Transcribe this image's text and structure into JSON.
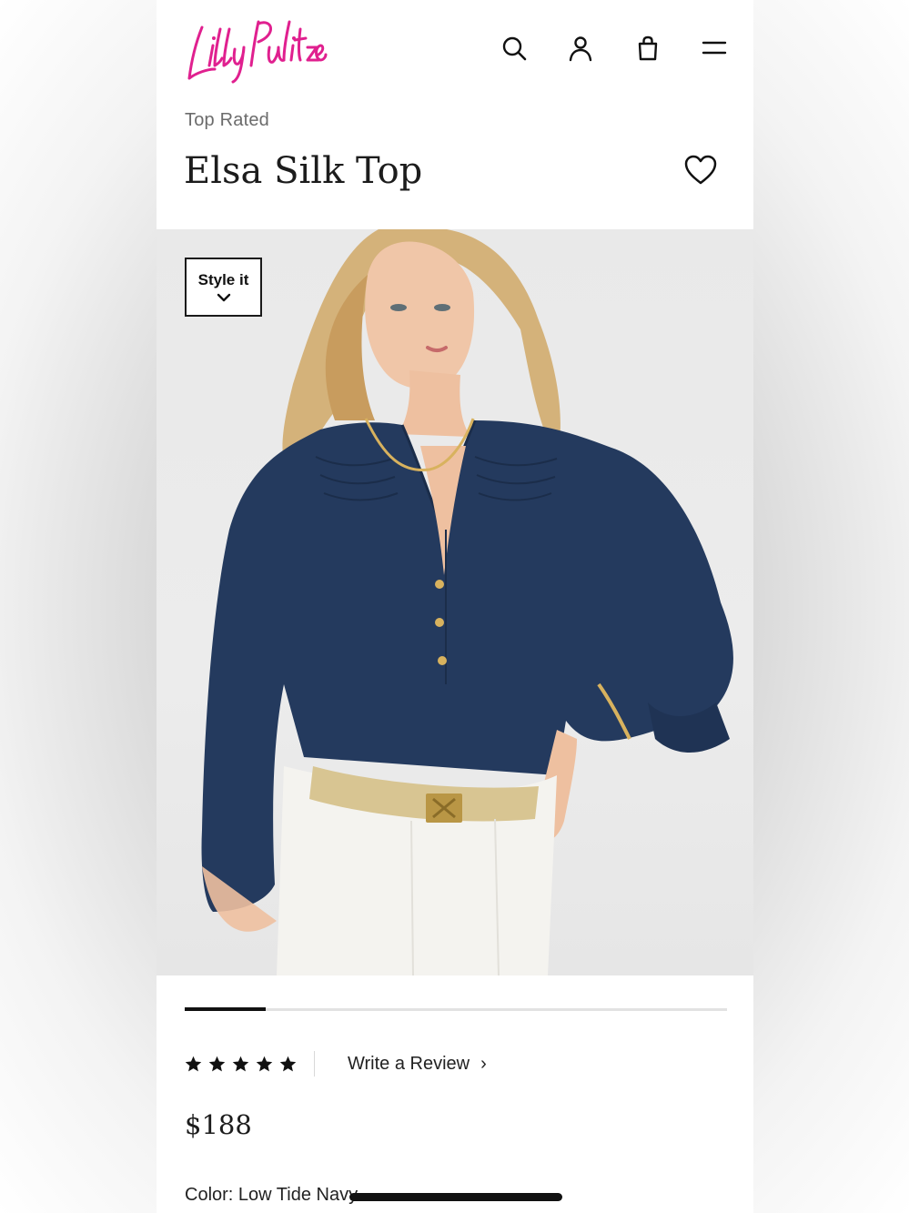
{
  "brand": {
    "logo_text": "Lilly Pulitzer",
    "logo_color": "#e0208f"
  },
  "header": {
    "icons": [
      "search-icon",
      "account-icon",
      "bag-icon",
      "menu-icon"
    ]
  },
  "product": {
    "eyebrow": "Top Rated",
    "title": "Elsa Silk Top",
    "style_it_label": "Style it",
    "price": "$188",
    "color_label": "Color: Low Tide Navy"
  },
  "gallery": {
    "progress_fraction": 0.15
  },
  "rating": {
    "stars": 5,
    "review_link": "Write a Review",
    "arrow": "›"
  },
  "colors": {
    "accent": "#e0208f",
    "text": "#1c1c1c",
    "muted": "#6b6b6b",
    "shirt": "#243a5e"
  }
}
